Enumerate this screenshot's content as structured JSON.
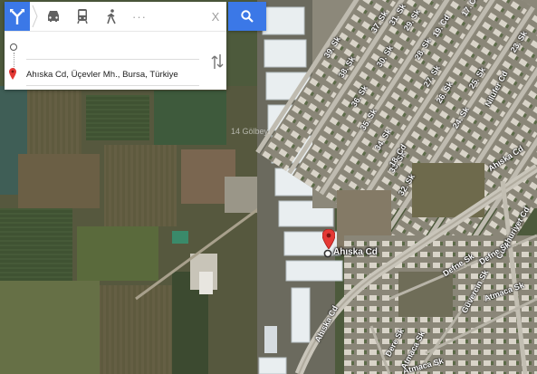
{
  "directions_panel": {
    "travel_modes": [
      "best-route-icon",
      "car-icon",
      "transit-icon",
      "walk-icon"
    ],
    "more_label": "···",
    "close_label": "X",
    "origin": {
      "value": ""
    },
    "destination": {
      "value": "Ahıska Cd, Üçevler Mh., Bursa, Türkiye"
    }
  },
  "map": {
    "marker_label": "Ahıska Cd",
    "watermark": "14 Gölbeyi",
    "street_labels": [
      "39. Sk",
      "38. Sk",
      "37. Sk",
      "36. Sk",
      "35. Sk",
      "34. Sk",
      "33. Sk",
      "32. Sk",
      "31. Sk",
      "30. Sk",
      "29. Sk",
      "28. Sk",
      "27. Sk",
      "26. Sk",
      "25. Sk",
      "24. Sk",
      "23. Sk",
      "22. Sk",
      "21. Sk",
      "19. Cd",
      "18. Cd",
      "17. Cd",
      "16. Sk",
      "Nilüfer Cd",
      "Ahıska Cd",
      "Ahıska Cd",
      "Ahıska Cd",
      "Cumhuriyet Cd",
      "Defne Sk",
      "Defne Sk",
      "Atmaca Sk",
      "Atmaca Sk",
      "Atmaca Sk",
      "Güvercin Sk",
      "Dere Sk"
    ]
  },
  "colors": {
    "accent": "#3b78e7",
    "marker": "#e53935"
  }
}
